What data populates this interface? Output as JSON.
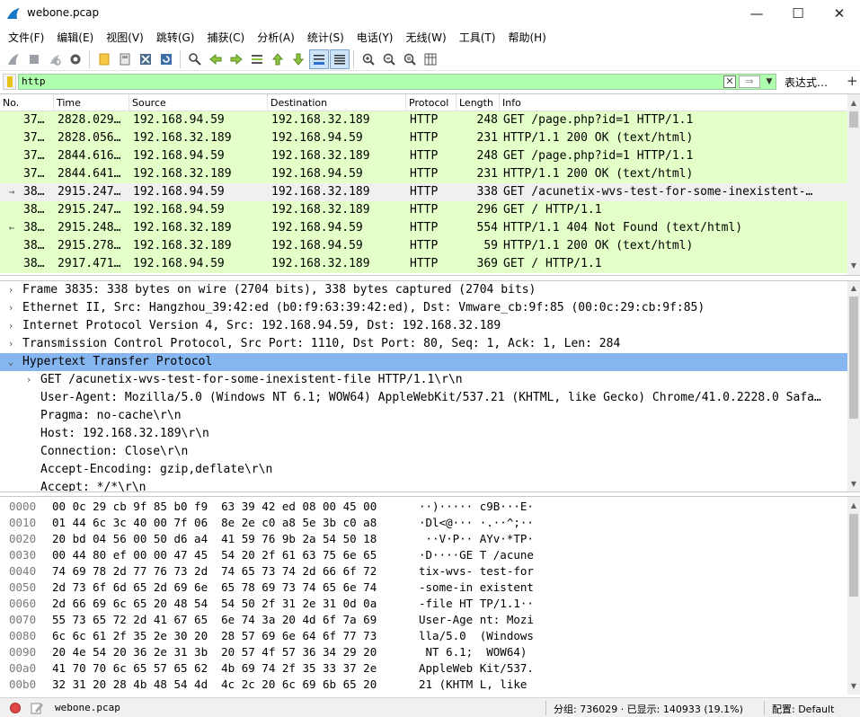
{
  "window": {
    "title": "webone.pcap",
    "minimize": "—",
    "maximize": "☐",
    "close": "✕"
  },
  "menu": [
    "文件(F)",
    "编辑(E)",
    "视图(V)",
    "跳转(G)",
    "捕获(C)",
    "分析(A)",
    "统计(S)",
    "电话(Y)",
    "无线(W)",
    "工具(T)",
    "帮助(H)"
  ],
  "filter": {
    "value": "http",
    "clear": "✕",
    "apply": "⇒",
    "dropdown": "▼",
    "expression_label": "表达式…",
    "add": "+"
  },
  "packet_list": {
    "columns": [
      "No.",
      "Time",
      "Source",
      "Destination",
      "Protocol",
      "Length",
      "Info"
    ],
    "rows": [
      {
        "no": "37…",
        "time": "2828.029…",
        "src": "192.168.94.59",
        "dst": "192.168.32.189",
        "proto": "HTTP",
        "len": "248",
        "info": "GET /page.php?id=1 HTTP/1.1",
        "marker": ""
      },
      {
        "no": "37…",
        "time": "2828.056…",
        "src": "192.168.32.189",
        "dst": "192.168.94.59",
        "proto": "HTTP",
        "len": "231",
        "info": "HTTP/1.1 200 OK  (text/html)",
        "marker": ""
      },
      {
        "no": "37…",
        "time": "2844.616…",
        "src": "192.168.94.59",
        "dst": "192.168.32.189",
        "proto": "HTTP",
        "len": "248",
        "info": "GET /page.php?id=1 HTTP/1.1",
        "marker": ""
      },
      {
        "no": "37…",
        "time": "2844.641…",
        "src": "192.168.32.189",
        "dst": "192.168.94.59",
        "proto": "HTTP",
        "len": "231",
        "info": "HTTP/1.1 200 OK  (text/html)",
        "marker": ""
      },
      {
        "no": "38…",
        "time": "2915.247…",
        "src": "192.168.94.59",
        "dst": "192.168.32.189",
        "proto": "HTTP",
        "len": "338",
        "info": "GET /acunetix-wvs-test-for-some-inexistent-…",
        "marker": "→",
        "selected": true
      },
      {
        "no": "38…",
        "time": "2915.247…",
        "src": "192.168.94.59",
        "dst": "192.168.32.189",
        "proto": "HTTP",
        "len": "296",
        "info": "GET / HTTP/1.1",
        "marker": ""
      },
      {
        "no": "38…",
        "time": "2915.248…",
        "src": "192.168.32.189",
        "dst": "192.168.94.59",
        "proto": "HTTP",
        "len": "554",
        "info": "HTTP/1.1 404 Not Found  (text/html)",
        "marker": "←"
      },
      {
        "no": "38…",
        "time": "2915.278…",
        "src": "192.168.32.189",
        "dst": "192.168.94.59",
        "proto": "HTTP",
        "len": "59",
        "info": "HTTP/1.1 200 OK  (text/html)",
        "marker": ""
      },
      {
        "no": "38…",
        "time": "2917.471…",
        "src": "192.168.94.59",
        "dst": "192.168.32.189",
        "proto": "HTTP",
        "len": "369",
        "info": "GET / HTTP/1.1",
        "marker": ""
      }
    ]
  },
  "details": [
    {
      "exp": "›",
      "indent": 0,
      "text": "Frame 3835: 338 bytes on wire (2704 bits), 338 bytes captured (2704 bits)"
    },
    {
      "exp": "›",
      "indent": 0,
      "text": "Ethernet II, Src: Hangzhou_39:42:ed (b0:f9:63:39:42:ed), Dst: Vmware_cb:9f:85 (00:0c:29:cb:9f:85)"
    },
    {
      "exp": "›",
      "indent": 0,
      "text": "Internet Protocol Version 4, Src: 192.168.94.59, Dst: 192.168.32.189"
    },
    {
      "exp": "›",
      "indent": 0,
      "text": "Transmission Control Protocol, Src Port: 1110, Dst Port: 80, Seq: 1, Ack: 1, Len: 284"
    },
    {
      "exp": "⌄",
      "indent": 0,
      "text": "Hypertext Transfer Protocol",
      "selected": true
    },
    {
      "exp": "›",
      "indent": 1,
      "text": "GET /acunetix-wvs-test-for-some-inexistent-file HTTP/1.1\\r\\n"
    },
    {
      "exp": "",
      "indent": 1,
      "text": "User-Agent: Mozilla/5.0 (Windows NT 6.1; WOW64) AppleWebKit/537.21 (KHTML, like Gecko) Chrome/41.0.2228.0 Safa…"
    },
    {
      "exp": "",
      "indent": 1,
      "text": "Pragma: no-cache\\r\\n"
    },
    {
      "exp": "",
      "indent": 1,
      "text": "Host: 192.168.32.189\\r\\n"
    },
    {
      "exp": "",
      "indent": 1,
      "text": "Connection: Close\\r\\n"
    },
    {
      "exp": "",
      "indent": 1,
      "text": "Accept-Encoding: gzip,deflate\\r\\n"
    },
    {
      "exp": "",
      "indent": 1,
      "text": "Accept: */*\\r\\n"
    }
  ],
  "bytes": [
    {
      "off": "0000",
      "hex": "00 0c 29 cb 9f 85 b0 f9  63 39 42 ed 08 00 45 00",
      "ascii": "··)····· c9B···E·"
    },
    {
      "off": "0010",
      "hex": "01 44 6c 3c 40 00 7f 06  8e 2e c0 a8 5e 3b c0 a8",
      "ascii": "·Dl<@··· ·.··^;··"
    },
    {
      "off": "0020",
      "hex": "20 bd 04 56 00 50 d6 a4  41 59 76 9b 2a 54 50 18",
      "ascii": " ··V·P·· AYv·*TP·"
    },
    {
      "off": "0030",
      "hex": "00 44 80 ef 00 00 47 45  54 20 2f 61 63 75 6e 65",
      "ascii": "·D····GE T /acune"
    },
    {
      "off": "0040",
      "hex": "74 69 78 2d 77 76 73 2d  74 65 73 74 2d 66 6f 72",
      "ascii": "tix-wvs- test-for"
    },
    {
      "off": "0050",
      "hex": "2d 73 6f 6d 65 2d 69 6e  65 78 69 73 74 65 6e 74",
      "ascii": "-some-in existent"
    },
    {
      "off": "0060",
      "hex": "2d 66 69 6c 65 20 48 54  54 50 2f 31 2e 31 0d 0a",
      "ascii": "-file HT TP/1.1··"
    },
    {
      "off": "0070",
      "hex": "55 73 65 72 2d 41 67 65  6e 74 3a 20 4d 6f 7a 69",
      "ascii": "User-Age nt: Mozi"
    },
    {
      "off": "0080",
      "hex": "6c 6c 61 2f 35 2e 30 20  28 57 69 6e 64 6f 77 73",
      "ascii": "lla/5.0  (Windows"
    },
    {
      "off": "0090",
      "hex": "20 4e 54 20 36 2e 31 3b  20 57 4f 57 36 34 29 20",
      "ascii": " NT 6.1;  WOW64) "
    },
    {
      "off": "00a0",
      "hex": "41 70 70 6c 65 57 65 62  4b 69 74 2f 35 33 37 2e",
      "ascii": "AppleWeb Kit/537."
    },
    {
      "off": "00b0",
      "hex": "32 31 20 28 4b 48 54 4d  4c 2c 20 6c 69 6b 65 20",
      "ascii": "21 (KHTM L, like "
    }
  ],
  "status": {
    "file": "webone.pcap",
    "stats": "分组: 736029 · 已显示: 140933 (19.1%)",
    "profile": "配置: Default"
  },
  "colors": {
    "http_row": "#e4ffc7",
    "selected_row": "#f0f0f0",
    "filter_ok": "#afffaf",
    "detail_selected": "#86b6f0"
  }
}
